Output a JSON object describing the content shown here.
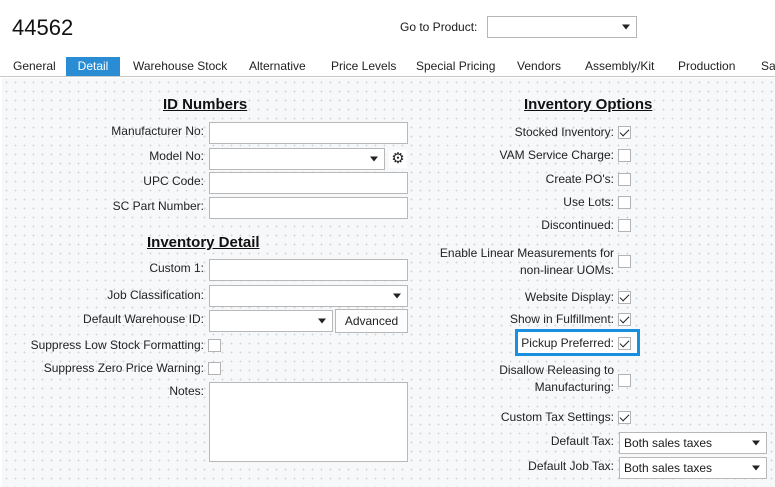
{
  "header": {
    "title": "44562",
    "goto_label": "Go to Product:",
    "goto_value": ""
  },
  "tabs": [
    {
      "label": "General",
      "active": false
    },
    {
      "label": "Detail",
      "active": true
    },
    {
      "label": "Warehouse Stock",
      "active": false
    },
    {
      "label": "Alternative",
      "active": false
    },
    {
      "label": "Price Levels",
      "active": false
    },
    {
      "label": "Special Pricing",
      "active": false
    },
    {
      "label": "Vendors",
      "active": false
    },
    {
      "label": "Assembly/Kit",
      "active": false
    },
    {
      "label": "Production",
      "active": false
    },
    {
      "label": "Sal",
      "active": false
    }
  ],
  "id_numbers": {
    "title": "ID Numbers",
    "manufacturer_no": {
      "label": "Manufacturer No:",
      "value": ""
    },
    "model_no": {
      "label": "Model No:",
      "value": ""
    },
    "upc_code": {
      "label": "UPC Code:",
      "value": ""
    },
    "sc_part_number": {
      "label": "SC Part Number:",
      "value": ""
    }
  },
  "inventory_detail": {
    "title": "Inventory Detail",
    "custom1": {
      "label": "Custom 1:",
      "value": ""
    },
    "job_classification": {
      "label": "Job Classification:",
      "value": ""
    },
    "default_warehouse": {
      "label": "Default Warehouse ID:",
      "value": ""
    },
    "advanced_label": "Advanced",
    "suppress_low_stock": {
      "label": "Suppress Low Stock Formatting:",
      "checked": false
    },
    "suppress_zero_price": {
      "label": "Suppress Zero Price Warning:",
      "checked": false
    },
    "notes": {
      "label": "Notes:",
      "value": ""
    }
  },
  "inventory_options": {
    "title": "Inventory Options",
    "stocked_inventory": {
      "label": "Stocked Inventory:",
      "checked": true
    },
    "vam_service_charge": {
      "label": "VAM Service Charge:",
      "checked": false
    },
    "create_pos": {
      "label": "Create PO's:",
      "checked": false
    },
    "use_lots": {
      "label": "Use Lots:",
      "checked": false
    },
    "discontinued": {
      "label": "Discontinued:",
      "checked": false
    },
    "enable_linear": {
      "label": "Enable Linear Measurements for non-linear UOMs:",
      "checked": false
    },
    "website_display": {
      "label": "Website Display:",
      "checked": true
    },
    "show_in_fulfillment": {
      "label": "Show in Fulfillment:",
      "checked": true
    },
    "pickup_preferred": {
      "label": "Pickup Preferred:",
      "checked": true
    },
    "disallow_releasing": {
      "label": "Disallow Releasing to Manufacturing:",
      "checked": false
    },
    "custom_tax_settings": {
      "label": "Custom Tax Settings:",
      "checked": true
    },
    "default_tax": {
      "label": "Default Tax:",
      "value": "Both sales taxes"
    },
    "default_job_tax": {
      "label": "Default Job Tax:",
      "value": "Both sales taxes"
    }
  },
  "colors": {
    "accent": "#2a8dd4",
    "highlight": "#1a8fe0"
  }
}
